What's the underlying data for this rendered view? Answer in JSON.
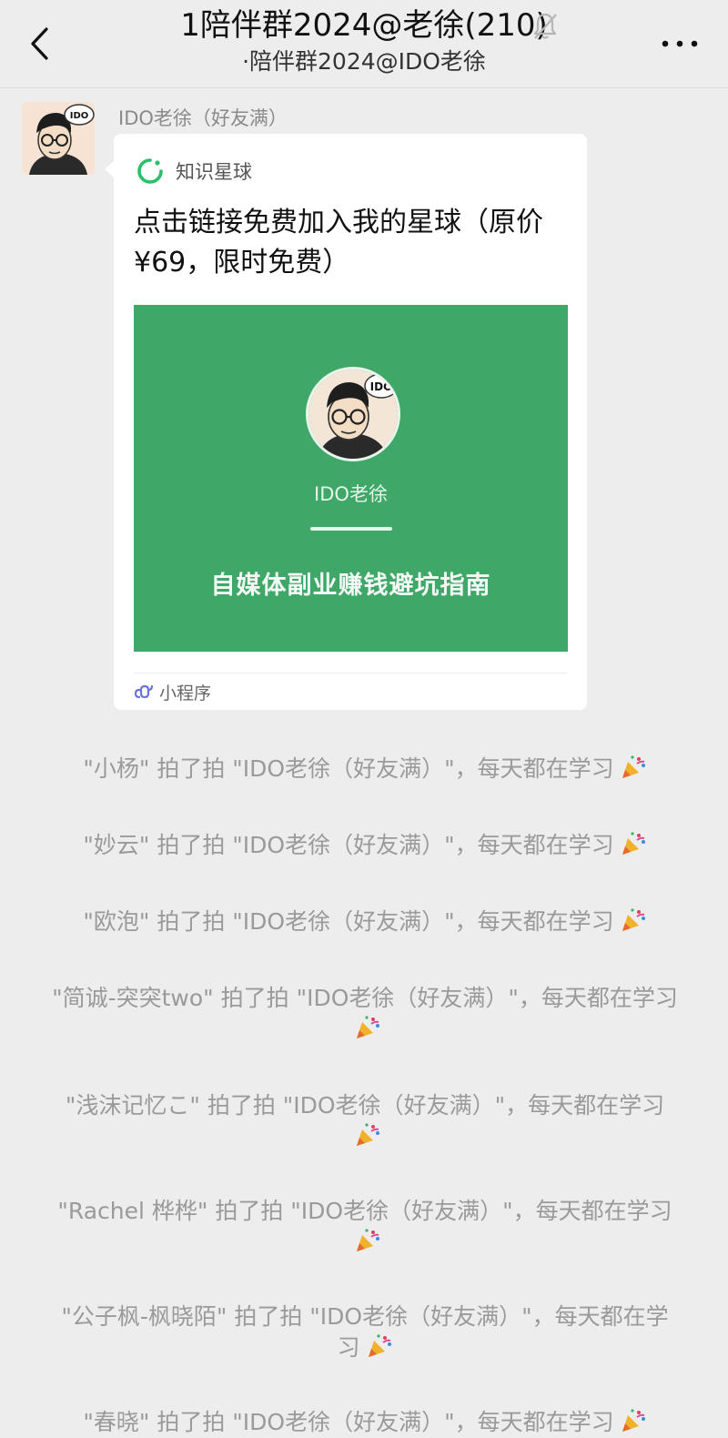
{
  "header": {
    "title": "1陪伴群2024@老徐(210)",
    "subtitle": "·陪伴群2024@IDO老徐"
  },
  "message": {
    "sender": "IDO老徐（好友满）",
    "card": {
      "app_name": "知识星球",
      "title": "点击链接免费加入我的星球（原价¥69，限时免费）",
      "image_name": "IDO老徐",
      "image_slogan": "自媒体副业赚钱避坑指南",
      "footer_label": "小程序"
    },
    "avatar_badge": "IDO"
  },
  "notices": [
    {
      "text": "\"小杨\" 拍了拍 \"IDO老徐（好友满）\"，每天都在学习"
    },
    {
      "text": "\"妙云\" 拍了拍 \"IDO老徐（好友满）\"，每天都在学习"
    },
    {
      "text": "\"欧泡\" 拍了拍 \"IDO老徐（好友满）\"，每天都在学习"
    },
    {
      "text": "\"简诚-突突two\" 拍了拍 \"IDO老徐（好友满）\"，每天都在学习"
    },
    {
      "text": "\"浅沫记忆こ\" 拍了拍 \"IDO老徐（好友满）\"，每天都在学习"
    },
    {
      "text": "\"Rachel 桦桦\" 拍了拍 \"IDO老徐（好友满）\"，每天都在学习"
    },
    {
      "text": "\"公子枫-枫晓陌\" 拍了拍 \"IDO老徐（好友满）\"，每天都在学习"
    },
    {
      "text": "\"春晓\" 拍了拍 \"IDO老徐（好友满）\"，每天都在学习"
    }
  ],
  "colors": {
    "background": "#ededed",
    "bubble": "#ffffff",
    "card_image": "#3fa768",
    "notice_text": "#9a9a9a",
    "app_accent": "#2bbf6a"
  }
}
